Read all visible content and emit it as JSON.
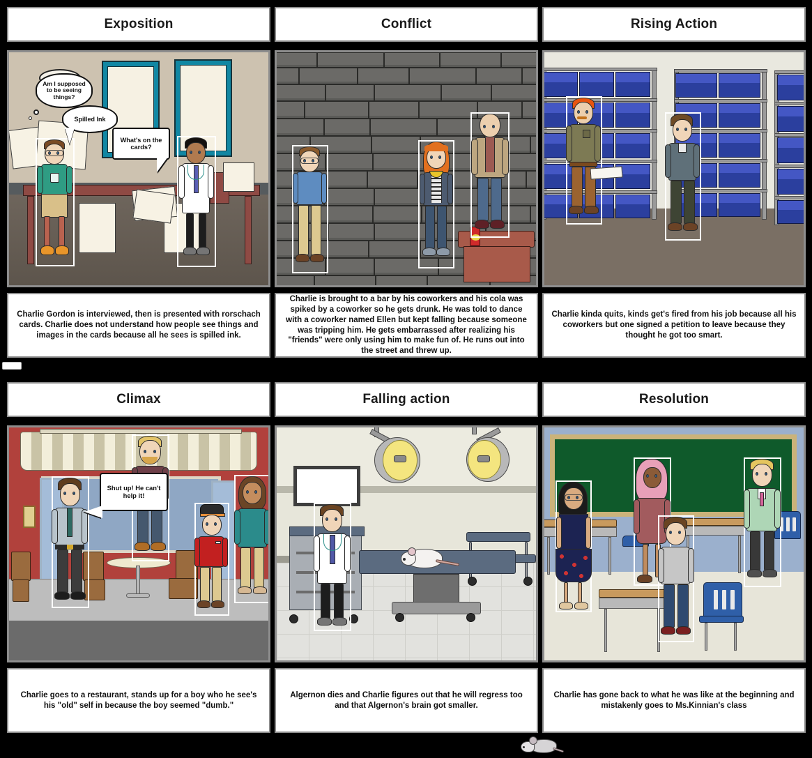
{
  "storyboard": {
    "title_font_color": "#1a1a1a",
    "panel_border_color": "#8d8d8d",
    "background_color": "#000000",
    "cells": [
      {
        "id": "exposition",
        "title": "Exposition",
        "caption": "Charlie Gordon is interviewed, then is presented with rorschach cards. Charlie does not understand how people see things and images in the cards because all he sees is spilled ink.",
        "scene": "interview-room",
        "bubbles": [
          {
            "name": "thought-bubble-seeing-things",
            "text": "Am I supposed to be seeing things?",
            "kind": "thought"
          },
          {
            "name": "speech-bubble-spilled-ink",
            "text": "Spilled Ink",
            "kind": "speech"
          },
          {
            "name": "speech-bubble-whats-on-the-cards",
            "text": "What's on the cards?",
            "kind": "speech"
          }
        ]
      },
      {
        "id": "conflict",
        "title": "Conflict",
        "caption": "Charlie is brought to a bar by his coworkers and his cola was spiked by a coworker so he gets drunk. He was told to dance with a coworker named Ellen but kept falling because someone was tripping him. He gets embarrassed after realizing his \"friends\" were only using him to make fun of. He runs out into the street and threw up.",
        "scene": "brick-wall-bar",
        "bubbles": []
      },
      {
        "id": "rising-action",
        "title": "Rising Action",
        "caption": "Charlie kinda quits, kinds get's fired from his job because all his coworkers but one signed a petition to leave because they thought he got too smart.",
        "scene": "warehouse",
        "bubbles": []
      },
      {
        "id": "climax",
        "title": "Climax",
        "caption": "Charlie goes to a restaurant, stands up for a boy who he see's his \"old\" self in because the boy seemed \"dumb.\"",
        "scene": "restaurant",
        "bubbles": [
          {
            "name": "speech-bubble-shut-up",
            "text": "Shut up! He can't help it!",
            "kind": "speech"
          }
        ]
      },
      {
        "id": "falling-action",
        "title": "Falling action",
        "caption": "Algernon dies and Charlie figures out that he will regress too and that Algernon's brain got smaller.",
        "scene": "operating-room",
        "bubbles": []
      },
      {
        "id": "resolution",
        "title": "Resolution",
        "caption": "Charlie has gone back to what he was like at the beginning and mistakenly goes to Ms.Kinnian's class",
        "scene": "classroom",
        "bubbles": []
      }
    ]
  },
  "decorations": {
    "footer_icon": "mouse-icon",
    "mid_handle": "resize-handle"
  }
}
